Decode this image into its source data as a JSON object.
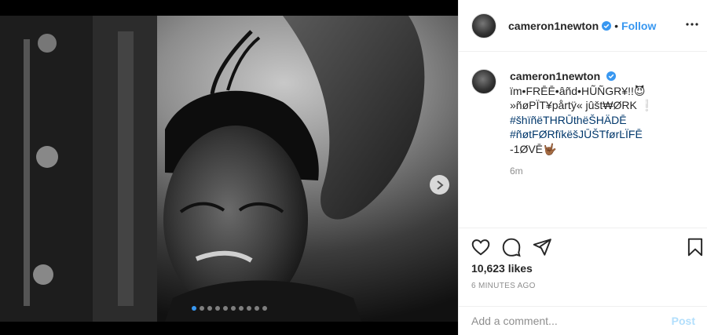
{
  "header": {
    "username": "cameron1newton",
    "separator": "•",
    "follow_label": "Follow"
  },
  "caption": {
    "username": "cameron1newton",
    "lines": [
      "ïm•FRĒĒ•âñd•HŨÑGR¥!!😈",
      "»ñøPÏT¥pårtÿ« jûšt₩ØRK ❕"
    ],
    "hashtags": [
      "#šhïñëTHRŪthëŠHÄDĒ",
      "#ñøtFØRfïkëšJŪŠTførĿÏFĒ"
    ],
    "last_line": "-1ØVĒ🤟🏾",
    "time": "6m"
  },
  "stats": {
    "likes": "10,623 likes",
    "posted": "6 MINUTES AGO"
  },
  "comment": {
    "placeholder": "Add a comment...",
    "post_label": "Post"
  },
  "carousel": {
    "total": 10,
    "active_index": 0
  },
  "colors": {
    "accent": "#3897f0",
    "hashtag": "#00376b",
    "muted": "#8e8e8e",
    "post_disabled": "#b2dffc"
  }
}
